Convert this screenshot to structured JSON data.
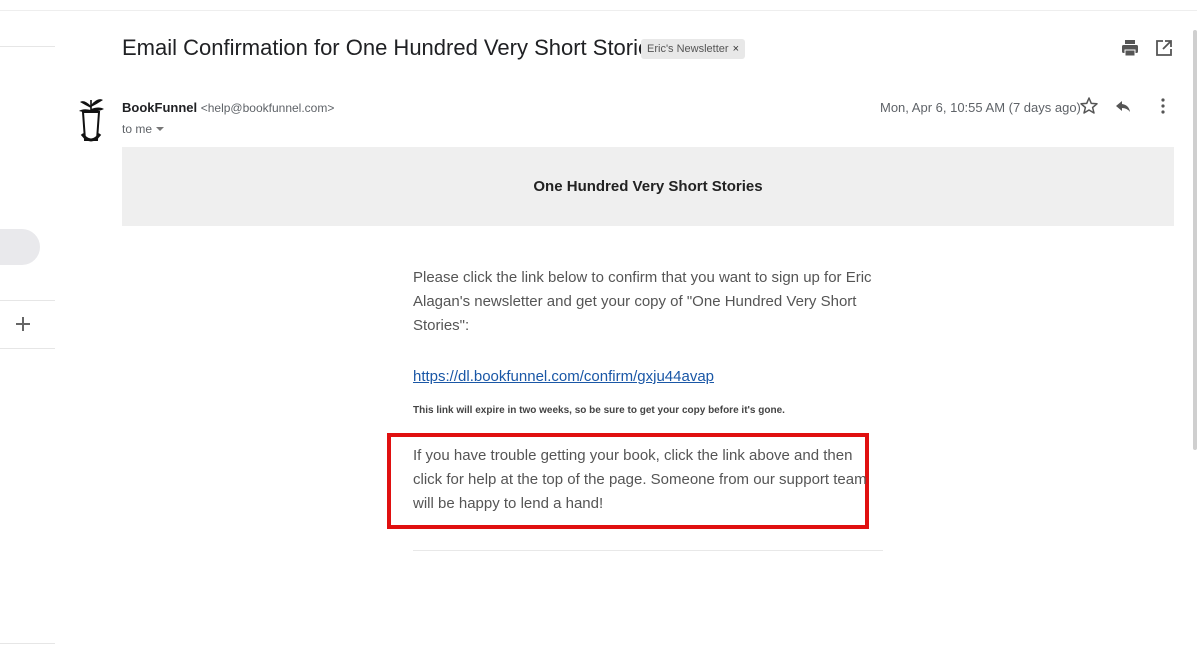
{
  "email": {
    "subject": "Email Confirmation for One Hundred Very Short Stories",
    "label": "Eric's Newsletter",
    "label_remove": "×",
    "sender_name": "BookFunnel",
    "sender_email": "<help@bookfunnel.com>",
    "recipient": "to me",
    "date": "Mon, Apr 6, 10:55 AM (7 days ago)"
  },
  "content": {
    "banner_title": "One Hundred Very Short Stories",
    "intro": "Please click the link below to confirm that you want to sign up for Eric Alagan's newsletter and get your copy of \"One Hundred Very Short Stories\":",
    "confirm_link": "https://dl.bookfunnel.com/confirm/gxju44avap",
    "expiry_note": "This link will expire in two weeks, so be sure to get your copy before it's gone.",
    "help_text": "If you have trouble getting your book, click the link above and then click for help at the top of the page. Someone from our support team will be happy to lend a hand!"
  },
  "icons": {
    "print": "print-icon",
    "open_new_window": "open-in-new-window-icon",
    "star": "star-icon",
    "reply": "reply-icon",
    "more": "more-options-icon",
    "add": "plus-icon",
    "avatar": "bookfunnel-logo"
  },
  "colors": {
    "highlight_border": "#e01010",
    "link": "#1a57a6",
    "banner_bg": "#efefef"
  }
}
